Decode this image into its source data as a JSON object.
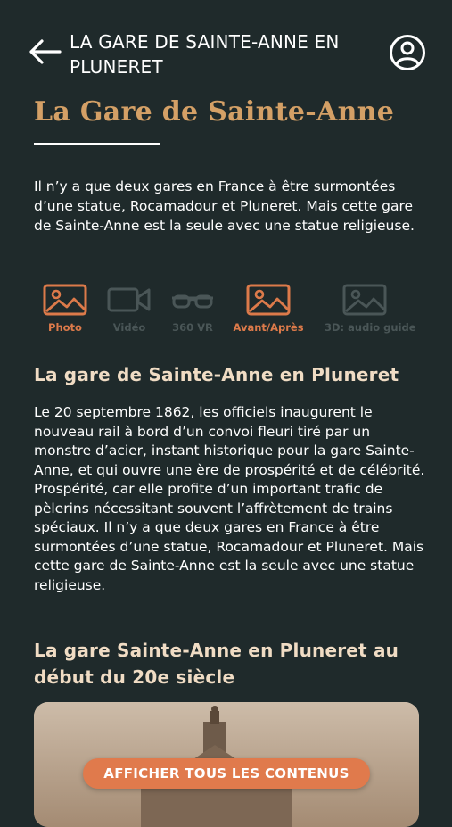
{
  "header": {
    "title": "LA GARE DE SAINTE-ANNE EN PLUNERET",
    "back_icon": "arrow-left-icon",
    "profile_icon": "user-circle-icon"
  },
  "page": {
    "title": "La Gare de Sainte-Anne",
    "intro": "Il n’y a que deux gares en France à être surmontées d’une statue, Rocamadour et Pluneret. Mais cette gare de Sainte-Anne est la seule avec une statue religieuse."
  },
  "media_tabs": [
    {
      "label": "Photo",
      "icon": "image-icon",
      "active": true
    },
    {
      "label": "Vidéo",
      "icon": "video-camera-icon",
      "active": false
    },
    {
      "label": "360 VR",
      "icon": "vr-glasses-icon",
      "active": false
    },
    {
      "label": "Avant/Après",
      "icon": "image-icon",
      "active": true
    },
    {
      "label": "3D: audio guide",
      "icon": "image-icon",
      "active": false
    }
  ],
  "sections": [
    {
      "heading": "La gare de Sainte-Anne en Pluneret",
      "text": "Le 20 septembre 1862, les officiels inaugurent le nouveau rail à bord d’un convoi fleuri tiré par un monstre d’acier, instant historique pour la gare Sainte-Anne, et qui ouvre une ère de prospérité et de célébrité. Prospérité, car elle profite d’un important trafic de pèlerins nécessitant souvent l’affrètement de trains spéciaux. Il n’y a que deux gares en France à être surmontées d’une statue, Rocamadour et Pluneret. Mais cette gare de Sainte-Anne est la seule avec une statue religieuse."
    },
    {
      "heading": "La gare Sainte-Anne en Pluneret au début du 20e siècle"
    }
  ],
  "cta": {
    "label": "AFFICHER TOUS LES CONTENUS"
  },
  "colors": {
    "background": "#1f2a2b",
    "accent": "#dc7a4a",
    "title_gold": "#d4a066",
    "disabled": "#4a5657"
  }
}
